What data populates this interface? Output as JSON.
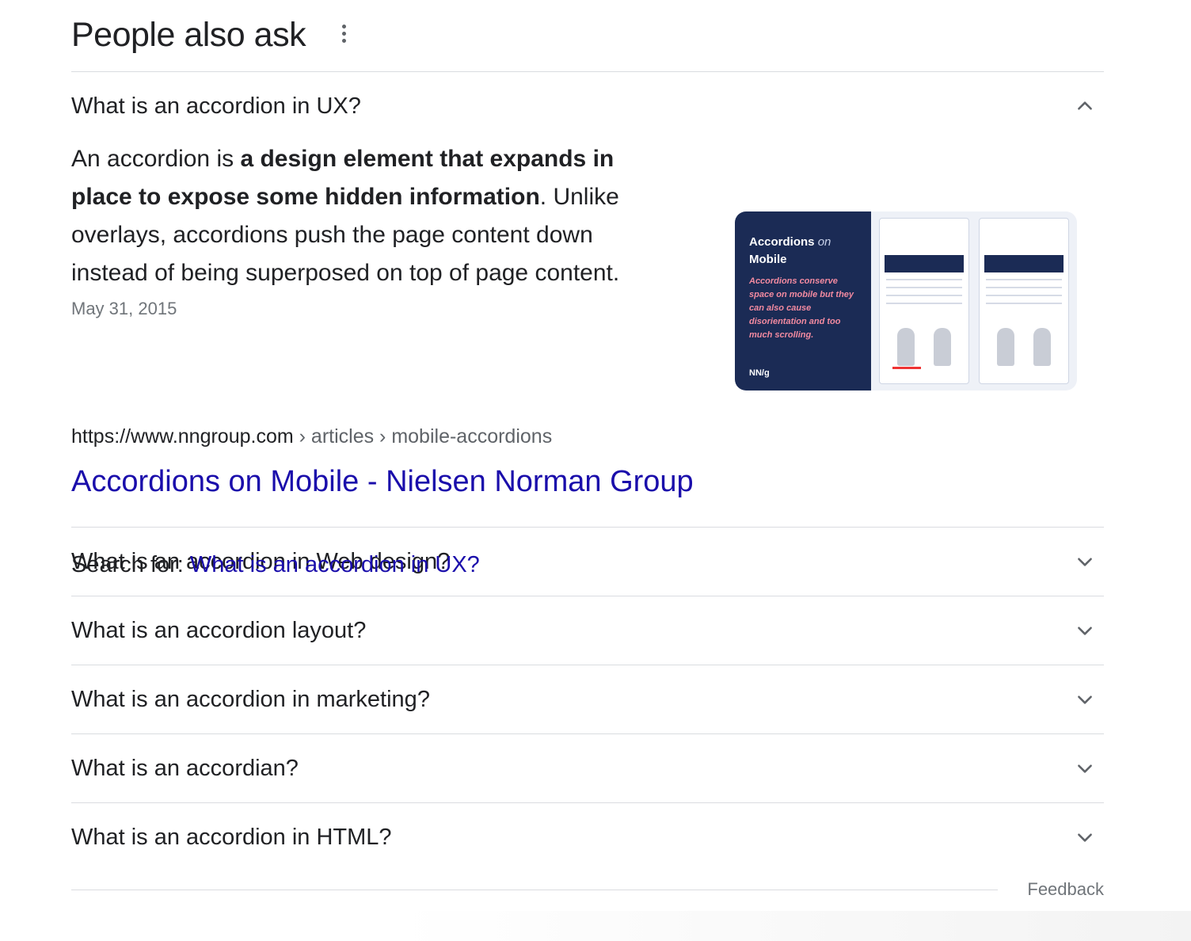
{
  "paa": {
    "title": "People also ask",
    "more_icon": "more-vert-icon",
    "expanded": {
      "question": "What is an accordion in UX?",
      "chevron_icon": "chevron-up-icon",
      "answer_prefix": "An accordion is ",
      "answer_bold": "a design element that expands in place to expose some hidden information",
      "answer_suffix": ". Unlike overlays, accordions push the page content down instead of being superposed on top of page content.",
      "date": "May 31, 2015",
      "thumbnail": {
        "title_main": "Accordions",
        "title_on": "on",
        "title_line2": "Mobile",
        "subtitle": "Accordions conserve space on mobile but they can also cause disorientation and too much scrolling.",
        "logo": "NN/g"
      },
      "source_url": "https://www.nngroup.com",
      "source_crumbs": " › articles › mobile-accordions",
      "result_title": "Accordions on Mobile - Nielsen Norman Group",
      "search_for_label": "Search for: ",
      "search_for_query": "What is an accordion in UX?"
    },
    "questions": [
      {
        "text": "What is an accordion in Web design?",
        "icon": "chevron-down-icon"
      },
      {
        "text": "What is an accordion layout?",
        "icon": "chevron-down-icon"
      },
      {
        "text": "What is an accordion in marketing?",
        "icon": "chevron-down-icon"
      },
      {
        "text": "What is an accordian?",
        "icon": "chevron-down-icon"
      },
      {
        "text": "What is an accordion in HTML?",
        "icon": "chevron-down-icon"
      }
    ],
    "feedback_label": "Feedback"
  },
  "colors": {
    "link": "#1a0dab",
    "text": "#202124",
    "muted": "#70757a",
    "divider": "#dadce0",
    "thumb_bg": "#1b2b55"
  }
}
